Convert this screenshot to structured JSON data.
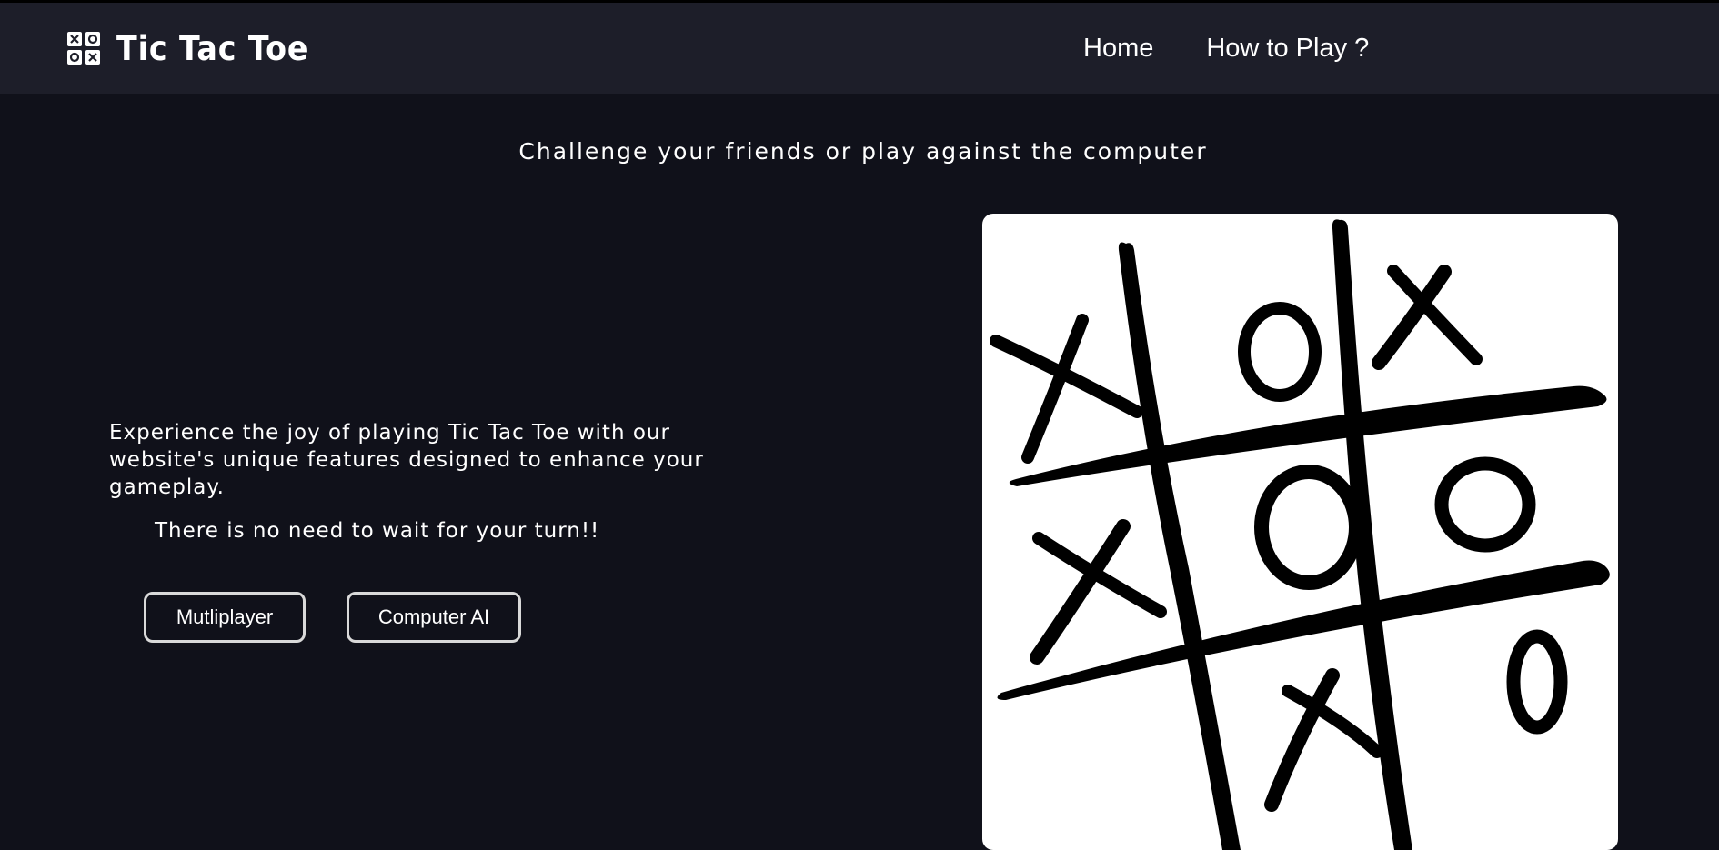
{
  "navbar": {
    "logo_icon": "tic-tac-toe-grid-icon",
    "title": "Tic Tac Toe",
    "links": [
      "Home",
      "How to Play ?"
    ]
  },
  "hero": {
    "tagline": "Challenge your friends or play against the computer",
    "description": "Experience the joy of playing Tic Tac Toe with our website's unique features designed to enhance your gameplay.",
    "subtext": "There is no need to wait for your turn!!",
    "buttons": {
      "multiplayer": "Mutliplayer",
      "computer_ai": "Computer AI"
    }
  },
  "image": {
    "subject": "hand-drawn tic tac toe board",
    "board": [
      "X",
      "O",
      "X",
      "X",
      "O",
      "O",
      "",
      "X",
      "O"
    ]
  },
  "colors": {
    "page_background": "#10111a",
    "navbar_background": "#1d1e29",
    "text": "#ffffff",
    "button_border": "#d9d9d9"
  }
}
